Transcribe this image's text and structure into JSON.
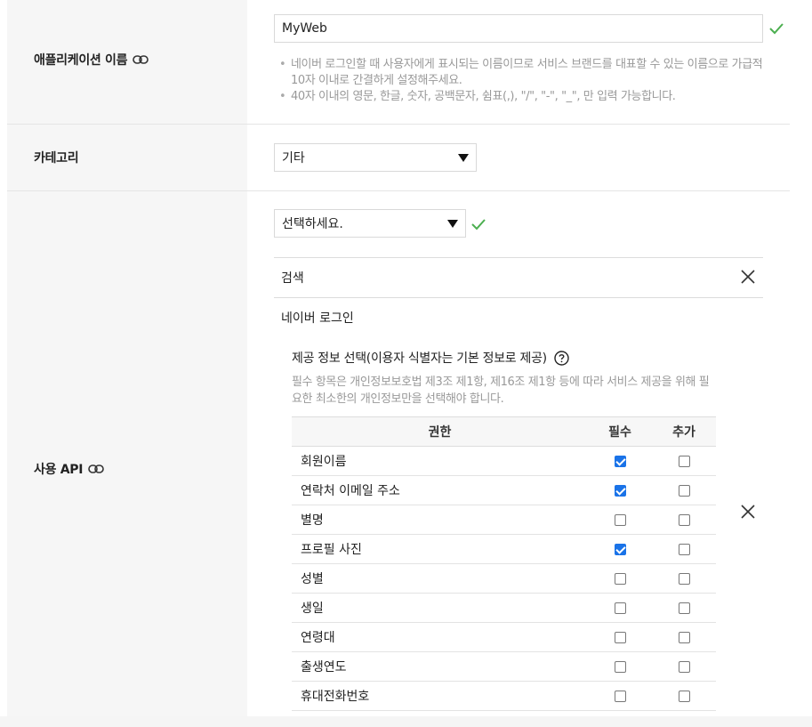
{
  "app_name": {
    "label": "애플리케이션 이름",
    "value": "MyWeb",
    "help": [
      "네이버 로그인할 때 사용자에게 표시되는 이름이므로 서비스 브랜드를 대표할 수 있는 이름으로 가급적 10자 이내로 간결하게 설정해주세요.",
      "40자 이내의 영문, 한글, 숫자, 공백문자, 쉼표(,), \"/\", \"-\", \"_\", 만 입력 가능합니다."
    ]
  },
  "category": {
    "label": "카테고리",
    "selected": "기타"
  },
  "api": {
    "label": "사용 API",
    "select_placeholder": "선택하세요.",
    "items": [
      {
        "name": "검색"
      },
      {
        "name": "네이버 로그인"
      }
    ],
    "provide": {
      "title": "제공 정보 선택(이용자 식별자는 기본 정보로 제공)",
      "description": "필수 항목은 개인정보보호법 제3조 제1항, 제16조 제1항 등에 따라 서비스 제공을 위해 필요한 최소한의 개인정보만을 선택해야 합니다.",
      "columns": [
        "권한",
        "필수",
        "추가"
      ],
      "rows": [
        {
          "name": "회원이름",
          "required": true,
          "extra": false
        },
        {
          "name": "연락처 이메일 주소",
          "required": true,
          "extra": false
        },
        {
          "name": "별명",
          "required": false,
          "extra": false
        },
        {
          "name": "프로필 사진",
          "required": true,
          "extra": false
        },
        {
          "name": "성별",
          "required": false,
          "extra": false
        },
        {
          "name": "생일",
          "required": false,
          "extra": false
        },
        {
          "name": "연령대",
          "required": false,
          "extra": false
        },
        {
          "name": "출생연도",
          "required": false,
          "extra": false
        },
        {
          "name": "휴대전화번호",
          "required": false,
          "extra": false
        }
      ]
    }
  },
  "colors": {
    "check_green": "#4caf50",
    "checkbox_blue": "#1a73e8",
    "label_bg": "#f6f6f6"
  },
  "icons": {
    "link": "link-icon",
    "check": "check-icon",
    "close": "close-icon",
    "help": "question-circle-icon",
    "dropdown": "caret-down-icon"
  }
}
